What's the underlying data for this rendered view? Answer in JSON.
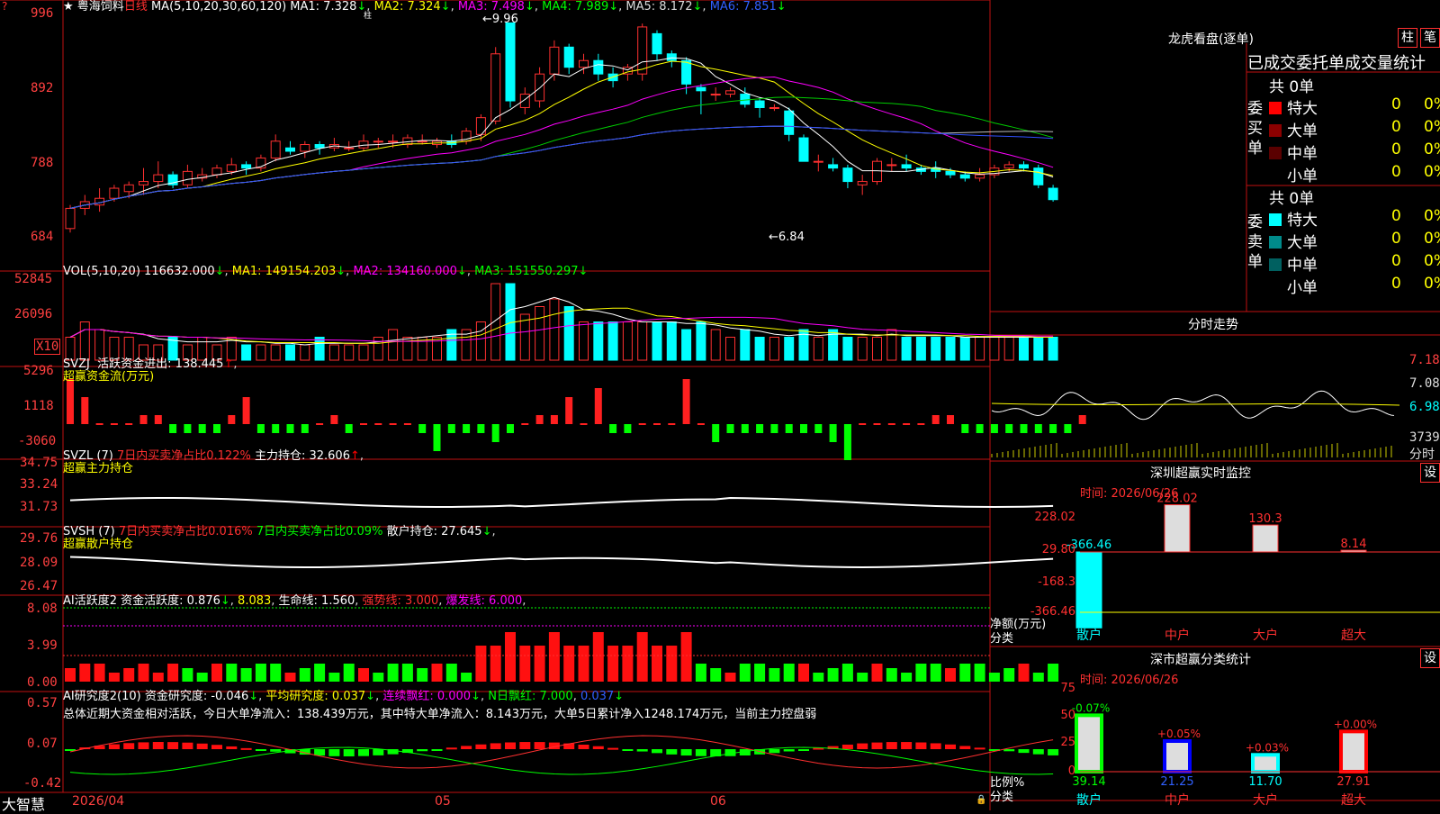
{
  "main_header": {
    "star": "★",
    "stock_name": "粤海饲料",
    "period": "日线",
    "ma_label": "MA(5,10,20,30,60,120)",
    "ma1": "MA1: 7.328",
    "ma2": "MA2: 7.324",
    "ma3": "MA3: 7.498",
    "ma4": "MA4: 7.989",
    "ma5": "MA5: 8.172",
    "ma6": "MA6: 7.851",
    "high_label": "9.96",
    "low_label": "6.84",
    "arrow_down": "↓",
    "arrow_up": "↑",
    "pin_mark": "柱"
  },
  "main_axis": [
    "996",
    "892",
    "788",
    "684"
  ],
  "vol_panel": {
    "title": "VOL(5,10,20)",
    "v": "116632.000",
    "ma1": "MA1: 149154.203",
    "ma2": "MA2: 134160.000",
    "ma3": "MA3: 151550.297",
    "axis": [
      "52845",
      "26096"
    ],
    "unit": "X10"
  },
  "svzj_panel": {
    "title": "SVZJ",
    "line1": "活跃资金进出: 138.445",
    "line2": "超赢资金流(万元)",
    "axis": [
      "5296",
      "1118",
      "-3060"
    ]
  },
  "svzl_panel": {
    "title": "SVZL (7)",
    "text1": "7日内买卖净占比0.122%",
    "text2": "主力持仓: 32.606",
    "line2": "超赢主力持仓",
    "axis": [
      "34.75",
      "33.24",
      "31.73"
    ]
  },
  "svsh_panel": {
    "title": "SVSH (7)",
    "text1": "7日内买卖净占比0.016%",
    "text2": "7日内买卖净占比0.09%",
    "text3": "散户持仓: 27.645",
    "line2": "超赢散户持仓",
    "axis": [
      "29.76",
      "28.09",
      "26.47"
    ]
  },
  "ai1_panel": {
    "title": "AI活跃度2",
    "t1": "资金活跃度: 0.876",
    "t2": "8.083",
    "t3": "生命线: 1.560",
    "t4": "强势线: 3.000",
    "t5": "爆发线: 6.000",
    "axis": [
      "8.08",
      "3.99",
      "0.00"
    ]
  },
  "ai2_panel": {
    "title": "AI研究度2(10)",
    "t1": "资金研究度: -0.046",
    "t2": "平均研究度: 0.037",
    "t3": "连续飘红: 0.000",
    "t4": "N日飘红: 7.000",
    "t5": "0.037",
    "summary": "总体近期大资金相对活跃，今日大单净流入：138.439万元，其中特大单净流入：8.143万元，大单5日累计净入1248.174万元，当前主力控盘弱",
    "axis": [
      "0.57",
      "0.07",
      "-0.42"
    ]
  },
  "footer": {
    "brand": "大智慧",
    "date": "2026/04",
    "m5": "05",
    "m6": "06"
  },
  "dragon_tiger": {
    "title": "龙虎看盘(逐单)",
    "btn_pillar": "柱",
    "btn_bi": "笔",
    "subtitle": "已成交委托单成交量统计",
    "buy_label": "委买单",
    "sell_label": "委卖单",
    "buy_total": "共 0单",
    "sell_total": "共 0单",
    "rows_buy": [
      {
        "name": "特大",
        "val": "0",
        "pct": "0%",
        "color": "#ff0000"
      },
      {
        "name": "大单",
        "val": "0",
        "pct": "0%",
        "color": "#8b0000"
      },
      {
        "name": "中单",
        "val": "0",
        "pct": "0%",
        "color": "#5a0000"
      },
      {
        "name": "小单",
        "val": "0",
        "pct": "0%",
        "color": "#000000"
      }
    ],
    "rows_sell": [
      {
        "name": "特大",
        "val": "0",
        "pct": "0%",
        "color": "#00ffff"
      },
      {
        "name": "大单",
        "val": "0",
        "pct": "0%",
        "color": "#008b8b"
      },
      {
        "name": "中单",
        "val": "0",
        "pct": "0%",
        "color": "#006060"
      },
      {
        "name": "小单",
        "val": "0",
        "pct": "0%",
        "color": "#000000"
      }
    ]
  },
  "intraday": {
    "title": "分时走势",
    "axis": [
      "7.18",
      "7.08",
      "6.98"
    ],
    "vol_axis": "3739",
    "vol_label": "分时"
  },
  "sz_monitor": {
    "title": "深圳超赢实时监控",
    "set": "设",
    "time_label": "时间: 2026/06/26",
    "axis": [
      "228.02",
      "29.80",
      "-168.3",
      "-366.46"
    ],
    "net_label": "净额(万元)",
    "cat_label": "分类",
    "bars": [
      {
        "name": "散户",
        "value": -366.46,
        "label": "-366.46"
      },
      {
        "name": "中户",
        "value": 228.02,
        "label": "228.02"
      },
      {
        "name": "大户",
        "value": 130.3,
        "label": "130.3"
      },
      {
        "name": "超大",
        "value": 8.14,
        "label": "8.14"
      }
    ]
  },
  "sz_classify": {
    "title": "深市超赢分类统计",
    "set": "设",
    "time_label": "时间: 2026/06/26",
    "axis": [
      "75",
      "50",
      "25",
      "0"
    ],
    "ratio_label": "比例%",
    "cat_label": "分类",
    "bars": [
      {
        "name": "散户",
        "value": 39.14,
        "change": "-0.07%",
        "label": "39.14"
      },
      {
        "name": "中户",
        "value": 21.25,
        "change": "+0.05%",
        "label": "21.25"
      },
      {
        "name": "大户",
        "value": 11.7,
        "change": "+0.03%",
        "label": "11.70"
      },
      {
        "name": "超大",
        "value": 27.91,
        "change": "+0.00%",
        "label": "27.91"
      }
    ]
  },
  "chart_data": {
    "type": "candlestick",
    "title": "粤海饲料 日线",
    "ylim": [
      6.84,
      9.96
    ],
    "candles": [
      [
        6.9,
        7.2,
        6.84,
        7.25
      ],
      [
        7.2,
        7.3,
        7.1,
        7.4
      ],
      [
        7.25,
        7.35,
        7.15,
        7.5
      ],
      [
        7.35,
        7.5,
        7.3,
        7.55
      ],
      [
        7.45,
        7.55,
        7.35,
        7.6
      ],
      [
        7.55,
        7.6,
        7.4,
        7.8
      ],
      [
        7.6,
        7.7,
        7.5,
        7.9
      ],
      [
        7.7,
        7.55,
        7.5,
        7.75
      ],
      [
        7.55,
        7.75,
        7.5,
        7.85
      ],
      [
        7.65,
        7.7,
        7.6,
        7.8
      ],
      [
        7.7,
        7.8,
        7.65,
        7.85
      ],
      [
        7.75,
        7.85,
        7.7,
        7.95
      ],
      [
        7.85,
        7.8,
        7.7,
        7.9
      ],
      [
        7.8,
        7.95,
        7.75,
        8.0
      ],
      [
        7.95,
        8.2,
        7.9,
        8.3
      ],
      [
        8.1,
        8.05,
        8.0,
        8.2
      ],
      [
        8.05,
        8.15,
        7.95,
        8.2
      ],
      [
        8.15,
        8.1,
        8.0,
        8.2
      ],
      [
        8.1,
        8.15,
        8.05,
        8.25
      ],
      [
        8.1,
        8.1,
        8.05,
        8.2
      ],
      [
        8.1,
        8.2,
        8.05,
        8.3
      ],
      [
        8.2,
        8.2,
        8.1,
        8.25
      ],
      [
        8.2,
        8.2,
        8.1,
        8.3
      ],
      [
        8.15,
        8.25,
        8.1,
        8.3
      ],
      [
        8.2,
        8.2,
        8.15,
        8.3
      ],
      [
        8.15,
        8.2,
        8.1,
        8.25
      ],
      [
        8.2,
        8.15,
        8.1,
        8.3
      ],
      [
        8.2,
        8.35,
        8.15,
        8.4
      ],
      [
        8.3,
        8.55,
        8.2,
        8.6
      ],
      [
        8.5,
        9.5,
        8.45,
        9.6
      ],
      [
        9.96,
        8.8,
        8.7,
        9.96
      ],
      [
        8.7,
        8.9,
        8.6,
        9.0
      ],
      [
        8.8,
        9.2,
        8.7,
        9.3
      ],
      [
        9.2,
        9.6,
        9.1,
        9.7
      ],
      [
        9.6,
        9.3,
        9.2,
        9.65
      ],
      [
        9.3,
        9.4,
        9.2,
        9.5
      ],
      [
        9.4,
        9.2,
        9.1,
        9.5
      ],
      [
        9.2,
        9.1,
        9.0,
        9.3
      ],
      [
        9.2,
        9.3,
        9.1,
        9.35
      ],
      [
        9.2,
        9.9,
        9.1,
        9.95
      ],
      [
        9.8,
        9.5,
        9.4,
        9.85
      ],
      [
        9.5,
        9.4,
        9.3,
        9.55
      ],
      [
        9.4,
        9.05,
        8.9,
        9.45
      ],
      [
        9.0,
        8.95,
        8.6,
        9.05
      ],
      [
        8.9,
        8.9,
        8.8,
        9.0
      ],
      [
        8.9,
        8.95,
        8.85,
        9.0
      ],
      [
        8.9,
        8.75,
        8.7,
        9.0
      ],
      [
        8.8,
        8.7,
        8.55,
        8.85
      ],
      [
        8.7,
        8.7,
        8.65,
        8.75
      ],
      [
        8.65,
        8.3,
        8.2,
        8.7
      ],
      [
        8.25,
        7.9,
        7.9,
        8.3
      ],
      [
        7.9,
        7.9,
        7.75,
        8.0
      ],
      [
        7.85,
        7.8,
        7.75,
        7.95
      ],
      [
        7.8,
        7.6,
        7.5,
        7.85
      ],
      [
        7.55,
        7.6,
        7.4,
        7.7
      ],
      [
        7.6,
        7.9,
        7.55,
        7.95
      ],
      [
        7.85,
        7.85,
        7.75,
        7.95
      ],
      [
        7.85,
        7.8,
        7.75,
        8.0
      ],
      [
        7.8,
        7.75,
        7.7,
        7.85
      ],
      [
        7.8,
        7.75,
        7.65,
        7.9
      ],
      [
        7.75,
        7.7,
        7.65,
        7.8
      ],
      [
        7.7,
        7.65,
        7.6,
        7.75
      ],
      [
        7.65,
        7.7,
        7.6,
        7.8
      ],
      [
        7.7,
        7.8,
        7.65,
        7.85
      ],
      [
        7.8,
        7.85,
        7.75,
        7.9
      ],
      [
        7.85,
        7.8,
        7.75,
        7.9
      ],
      [
        7.8,
        7.55,
        7.5,
        7.85
      ],
      [
        7.5,
        7.33,
        7.3,
        7.55
      ]
    ],
    "volume": [
      3,
      5,
      4,
      3,
      3,
      2,
      2,
      3,
      2,
      3,
      2,
      3,
      2,
      2,
      2,
      2,
      2,
      3,
      2,
      2,
      2,
      3,
      4,
      3,
      3,
      3,
      4,
      4,
      5,
      10,
      10,
      6,
      7,
      8,
      7,
      5,
      5,
      5,
      5,
      5,
      5,
      5,
      4,
      5,
      4,
      3,
      4,
      3,
      3,
      3,
      4,
      3,
      4,
      3,
      3,
      3,
      4,
      3,
      3,
      3,
      3,
      3,
      3,
      3,
      3,
      3,
      3,
      3
    ],
    "fund_flow": [
      5,
      3,
      0,
      0,
      0,
      1,
      1,
      -1,
      -1,
      -1,
      -1,
      1,
      3,
      -1,
      -1,
      -1,
      -1,
      0,
      1,
      -1,
      0,
      0,
      0,
      0,
      -1,
      -3,
      -1,
      -1,
      -1,
      -2,
      -1,
      0,
      1,
      1,
      3,
      0,
      4,
      -1,
      -1,
      0,
      0,
      0,
      5,
      0,
      -2,
      -1,
      -1,
      -1,
      -1,
      -1,
      -1,
      -1,
      -2,
      -4,
      0,
      0,
      0,
      0,
      0,
      1,
      1,
      -1,
      -1,
      -1,
      -1,
      -1,
      -1,
      -1,
      -1,
      1
    ]
  }
}
